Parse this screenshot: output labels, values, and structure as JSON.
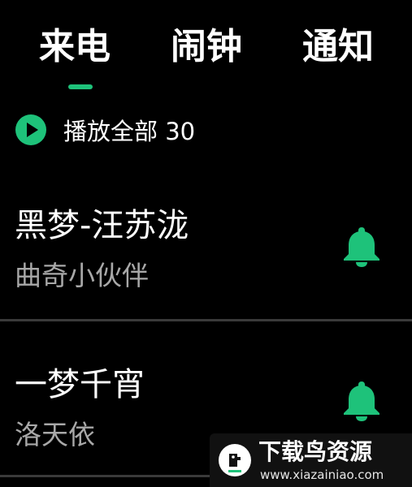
{
  "tabs": [
    {
      "label": "来电",
      "selected": true
    },
    {
      "label": "闹钟",
      "selected": false
    },
    {
      "label": "通知",
      "selected": false
    }
  ],
  "accent_color": "#1ec27a",
  "play_all": {
    "label": "播放全部 30",
    "icon": "play-circle-icon"
  },
  "songs": [
    {
      "title": "黑梦-汪苏泷",
      "artist": "曲奇小伙伴",
      "icon": "bell-icon"
    },
    {
      "title": "一梦千宵",
      "artist": "洛天依",
      "icon": "bell-icon"
    }
  ],
  "watermark": {
    "title": "下载鸟资源",
    "url": "www.xiazainiao.com"
  }
}
